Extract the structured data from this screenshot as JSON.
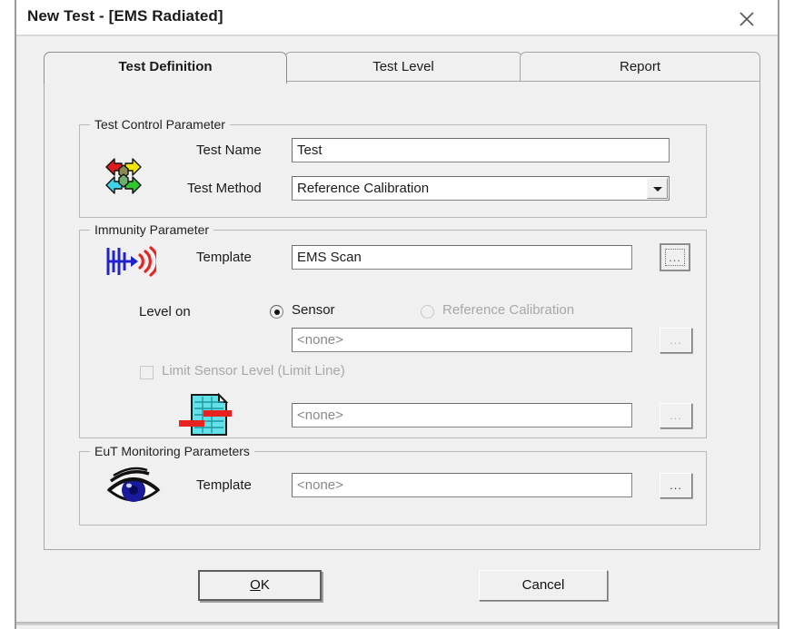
{
  "window": {
    "title": "New Test - [EMS Radiated]",
    "close_icon": "close-icon"
  },
  "tabs": [
    {
      "label": "Test Definition",
      "active": true
    },
    {
      "label": "Test Level",
      "active": false
    },
    {
      "label": "Report",
      "active": false
    }
  ],
  "test_control": {
    "group_title": "Test Control Parameter",
    "icon": "cycle-arrows-icon",
    "test_name_label": "Test Name",
    "test_name_value": "Test",
    "test_method_label": "Test Method",
    "test_method_value": "Reference Calibration",
    "test_method_options": [
      "Reference Calibration"
    ]
  },
  "immunity": {
    "group_title": "Immunity Parameter",
    "icon": "ems-radiation-icon",
    "template_label": "Template",
    "template_value": "EMS Scan",
    "template_browse": "...",
    "level_on_label": "Level on",
    "radio_sensor_label": "Sensor",
    "radio_sensor_selected": true,
    "radio_refcal_label": "Reference Calibration",
    "radio_refcal_selected": false,
    "sensor_value": "<none>",
    "sensor_browse": "...",
    "limit_checkbox_label": "Limit Sensor Level (Limit Line)",
    "limit_checkbox_checked": false,
    "limit_icon": "limit-line-document-icon",
    "limit_value": "<none>",
    "limit_browse": "..."
  },
  "eut": {
    "group_title": "EuT Monitoring Parameters",
    "icon": "eye-icon",
    "template_label": "Template",
    "template_value": "<none>",
    "template_browse": "..."
  },
  "footer": {
    "ok_label": "OK",
    "ok_accel": "O",
    "ok_rest": "K",
    "cancel_label": "Cancel"
  },
  "colors": {
    "dialog_bg": "#f0f0f0",
    "field_bg": "#ffffff",
    "text": "#1b1b1b",
    "disabled_text": "#a8a8a8",
    "icon_red": "#e8231f",
    "icon_blue": "#2222cc",
    "icon_cyan": "#63e0e8",
    "icon_yellow": "#f2e500",
    "icon_green": "#2fc82f",
    "eye_iris": "#1a1a9c"
  }
}
